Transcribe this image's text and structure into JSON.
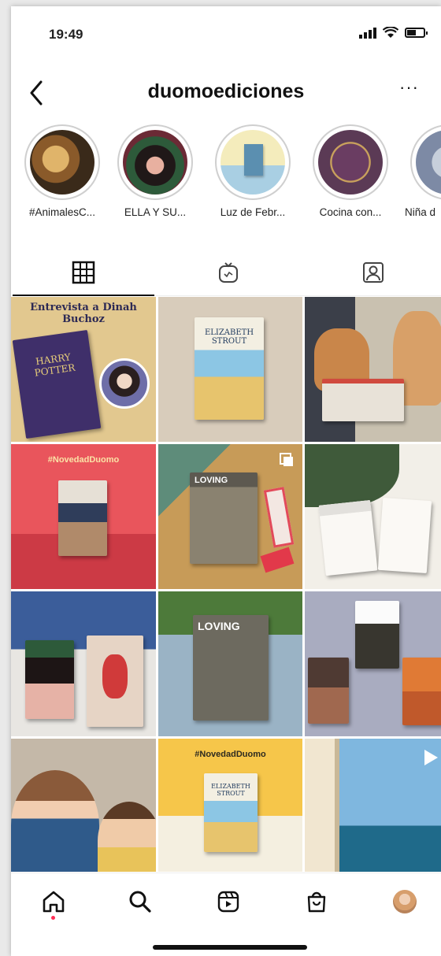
{
  "status_bar": {
    "time": "19:49"
  },
  "header": {
    "username": "duomoediciones",
    "back_icon": "chevron-left-icon",
    "more_label": "···"
  },
  "highlights": [
    {
      "label": "#AnimalesC...",
      "color": "#c8a05a"
    },
    {
      "label": "ELLA Y SU...",
      "color": "#7a3a3a"
    },
    {
      "label": "Luz de Febr...",
      "color": "#f0e7b8"
    },
    {
      "label": "Cocina con...",
      "color": "#5e3a5a"
    },
    {
      "label": "Niña d",
      "color": "#9aa3b5"
    }
  ],
  "tabs": [
    {
      "name": "posts-grid-icon",
      "active": true
    },
    {
      "name": "igtv-icon",
      "active": false
    },
    {
      "name": "tagged-icon",
      "active": false
    }
  ],
  "posts": {
    "p1_heading": "Entrevista a Dinah Buchoz",
    "p1_book_title": "HARRY POTTER",
    "p2_book_author": "ELIZABETH STROUT",
    "p4_hashtag": "#NovedadDuomo",
    "p5_book_title": "LOVING",
    "p8_book_title": "LOVING",
    "p11_hashtag": "#NovedadDuomo",
    "p11_book_author": "ELIZABETH STROUT"
  },
  "nav": [
    "home-icon",
    "search-icon",
    "reels-icon",
    "shop-icon",
    "profile-avatar"
  ],
  "colors": {
    "accent_dot": "#ff2d55",
    "p4_bg": "#e9555c",
    "p11_bg": "#f6c64a"
  }
}
